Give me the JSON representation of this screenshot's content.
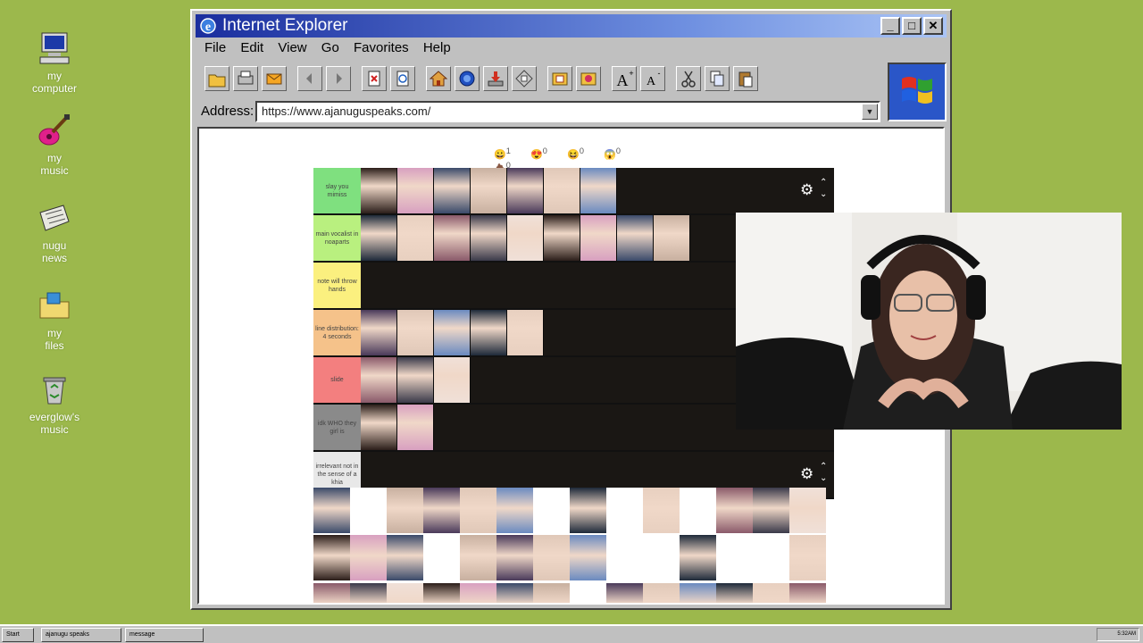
{
  "desktop": {
    "icons": [
      {
        "label1": "my",
        "label2": "computer",
        "icon": "computer-icon"
      },
      {
        "label1": "my",
        "label2": "music",
        "icon": "guitar-icon"
      },
      {
        "label1": "nugu",
        "label2": "news",
        "icon": "newspaper-icon"
      },
      {
        "label1": "my",
        "label2": "files",
        "icon": "folder-icon"
      },
      {
        "label1": "everglow's",
        "label2": "music",
        "icon": "recycle-bin-icon"
      }
    ]
  },
  "browser": {
    "title": "Internet Explorer",
    "menu": [
      "File",
      "Edit",
      "View",
      "Go",
      "Favorites",
      "Help"
    ],
    "address_label": "Address:",
    "address_value": "https://www.ajanuguspeaks.com/"
  },
  "page": {
    "reactions": [
      {
        "icon": "smile-emoji-icon",
        "count": "1"
      },
      {
        "icon": "heart-eyes-emoji-icon",
        "count": "0"
      },
      {
        "icon": "laugh-emoji-icon",
        "count": "0"
      },
      {
        "icon": "surprised-emoji-icon",
        "count": "0"
      },
      {
        "icon": "poop-emoji-icon",
        "count": "0"
      }
    ],
    "tiers": [
      {
        "label": "slay you mimiss",
        "color": "#7fe07f",
        "count": 7
      },
      {
        "label": "main vocalist in noaparts",
        "color": "#b9f07f",
        "count": 9
      },
      {
        "label": "note will throw hands",
        "color": "#fbf07f",
        "count": 0
      },
      {
        "label": "line distribution: 4 seconds",
        "color": "#f5c28a",
        "count": 5
      },
      {
        "label": "slide",
        "color": "#f37f7f",
        "count": 3
      },
      {
        "label": "idk WHO they girl is",
        "color": "#8a8a8a",
        "count": 2
      },
      {
        "label": "irrelevant not in the sense of a khia",
        "color": "#e8e8e8",
        "count": 0
      }
    ]
  },
  "taskbar": {
    "start_label": "Start",
    "tasks": [
      "ajanugu speaks",
      "message"
    ],
    "clock": "5:32AM"
  },
  "colors": {
    "desktop": "#9cb84c",
    "titlebar_start": "#1a2e9e",
    "titlebar_end": "#aac4f5",
    "tier_bg": "#1a1714"
  }
}
